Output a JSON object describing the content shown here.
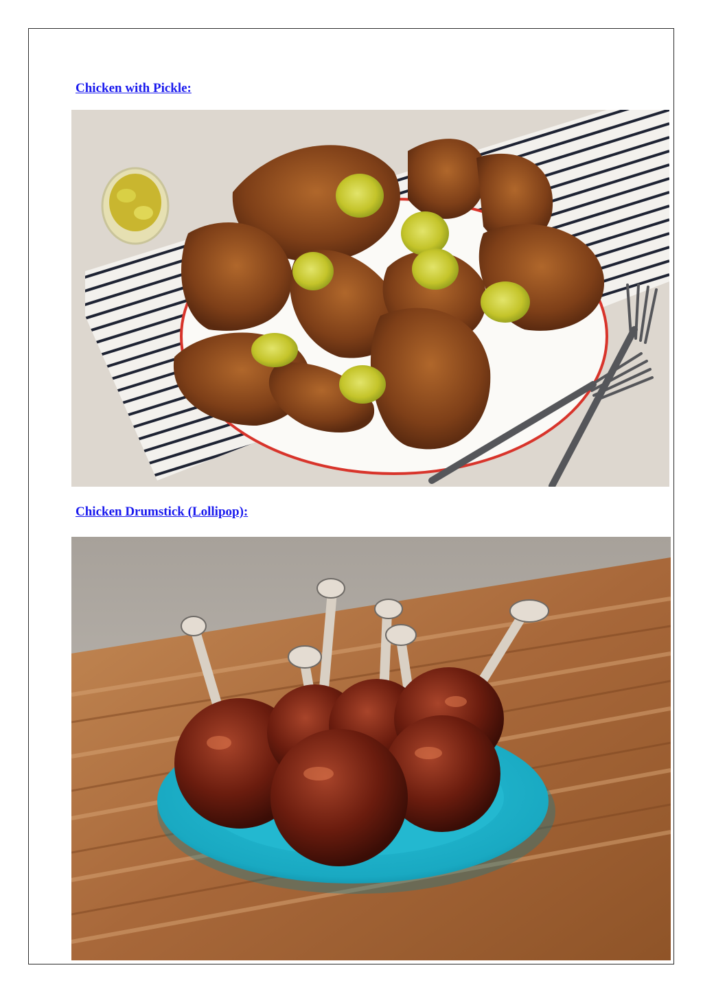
{
  "sections": [
    {
      "heading": "Chicken with Pickle:",
      "image": {
        "subject": "fried-chicken-with-pickle-slices",
        "colors": {
          "background": "#ded8d0",
          "towel": "#f4f2ee",
          "towel_stripe": "#1e2333",
          "plate_rim": "#d8342b",
          "chicken": "#8a4a1e",
          "pickle": "#c6c62c",
          "fork": "#55565a"
        }
      }
    },
    {
      "heading": "Chicken Drumstick (Lollipop):",
      "image": {
        "subject": "bbq-chicken-lollipop-drumsticks",
        "colors": {
          "wall": "#b9b3ab",
          "board": "#a8683a",
          "board_light": "#d6a272",
          "plate": "#1fb6cf",
          "chicken": "#6a1c0e",
          "bone": "#d9d0c4"
        }
      }
    }
  ]
}
